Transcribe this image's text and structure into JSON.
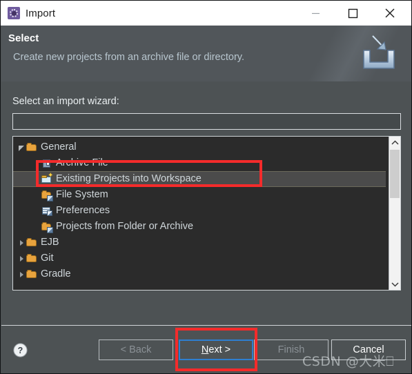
{
  "window": {
    "title": "Import",
    "icon": "import-wizard-icon",
    "controls": {
      "minimize": "minimize-icon",
      "maximize": "maximize-icon",
      "close": "close-icon"
    }
  },
  "banner": {
    "title": "Select",
    "description": "Create new projects from an archive file or directory.",
    "icon": "import-tray-icon"
  },
  "main": {
    "wizard_label": "Select an import wizard:",
    "filter": {
      "value": "",
      "placeholder": ""
    },
    "tree": [
      {
        "label": "General",
        "indent": 0,
        "twisty": "expanded",
        "icon": "folder-open-icon",
        "selected": false
      },
      {
        "label": "Archive File",
        "indent": 1,
        "twisty": "none",
        "icon": "archive-file-icon",
        "selected": false
      },
      {
        "label": "Existing Projects into Workspace",
        "indent": 1,
        "twisty": "none",
        "icon": "folder-star-icon",
        "selected": true
      },
      {
        "label": "File System",
        "indent": 1,
        "twisty": "none",
        "icon": "folder-pencil-icon",
        "selected": false
      },
      {
        "label": "Preferences",
        "indent": 1,
        "twisty": "none",
        "icon": "preferences-icon",
        "selected": false
      },
      {
        "label": "Projects from Folder or Archive",
        "indent": 1,
        "twisty": "none",
        "icon": "folder-pencil-icon",
        "selected": false
      },
      {
        "label": "EJB",
        "indent": 0,
        "twisty": "collapsed",
        "icon": "folder-open-icon",
        "selected": false
      },
      {
        "label": "Git",
        "indent": 0,
        "twisty": "collapsed",
        "icon": "folder-open-icon",
        "selected": false
      },
      {
        "label": "Gradle",
        "indent": 0,
        "twisty": "collapsed",
        "icon": "folder-open-icon",
        "selected": false
      }
    ],
    "scrollbar": {
      "up": "chevron-up-icon",
      "down": "chevron-down-icon"
    }
  },
  "footer": {
    "help": "help-icon",
    "buttons": {
      "back": {
        "label": "< Back",
        "enabled": false,
        "focused": false
      },
      "next_prefix": "",
      "next_mnemonic": "N",
      "next_suffix": "ext >",
      "next_label": "Next >",
      "finish": {
        "label": "Finish",
        "enabled": false,
        "focused": false
      },
      "cancel": {
        "label": "Cancel",
        "enabled": true,
        "focused": false
      }
    }
  },
  "annotations": [
    {
      "name": "highlight-existing-projects",
      "color": "#f42b2b"
    },
    {
      "name": "highlight-next-button",
      "color": "#f42b2b"
    }
  ],
  "watermark": {
    "text": "CSDN @大米⎕"
  }
}
